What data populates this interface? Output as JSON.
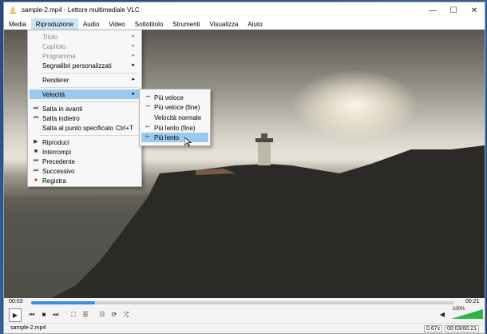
{
  "window": {
    "title": "sample-2.mp4 - Lettore multimediale VLC",
    "min_glyph": "—",
    "max_glyph": "☐",
    "close_glyph": "✕"
  },
  "menubar": [
    "Media",
    "Riproduzione",
    "Audio",
    "Video",
    "Sottotitolo",
    "Strumenti",
    "Visualizza",
    "Aiuto"
  ],
  "playback_menu": {
    "items": [
      {
        "label": "Titolo",
        "disabled": true,
        "submenu": true
      },
      {
        "label": "Capitolo",
        "disabled": true,
        "submenu": true
      },
      {
        "label": "Programma",
        "disabled": true,
        "submenu": true
      },
      {
        "label": "Segnalibri personalizzati",
        "disabled": false,
        "submenu": true
      },
      {
        "label": "Renderer",
        "disabled": false,
        "submenu": true
      },
      {
        "label": "Velocità",
        "disabled": false,
        "submenu": true,
        "highlighted": true
      },
      {
        "label": "Salta in avanti",
        "icon": "skip-forward-icon",
        "glyph": "⏭"
      },
      {
        "label": "Salta indietro",
        "icon": "skip-back-icon",
        "glyph": "⏮"
      },
      {
        "label": "Salta al punto specificato",
        "shortcut": "Ctrl+T"
      },
      {
        "label": "Riproduci",
        "icon": "play-icon",
        "glyph": "▶"
      },
      {
        "label": "Interrompi",
        "icon": "stop-icon",
        "glyph": "■"
      },
      {
        "label": "Precedente",
        "icon": "previous-icon",
        "glyph": "⏮"
      },
      {
        "label": "Successivo",
        "icon": "next-icon",
        "glyph": "⏭"
      },
      {
        "label": "Registra",
        "icon": "record-icon",
        "glyph": "●"
      }
    ]
  },
  "speed_menu": {
    "items": [
      {
        "label": "Più veloce",
        "icon": "faster-icon",
        "glyph": "⇀"
      },
      {
        "label": "Più veloce (fine)",
        "icon": "faster-fine-icon",
        "glyph": "⇀"
      },
      {
        "label": "Velocità normale",
        "icon": "normal-speed-icon",
        "glyph": ""
      },
      {
        "label": "Più lento (fine)",
        "icon": "slower-fine-icon",
        "glyph": "↼"
      },
      {
        "label": "Più lento",
        "icon": "slower-icon",
        "glyph": "↼",
        "highlighted": true
      }
    ]
  },
  "controls": {
    "elapsed": "00:03",
    "total": "00:21",
    "progress": 0.15,
    "volume_pct": "100%",
    "volume_level": 1.0,
    "speed": "0.67x",
    "time_status": "00:03/00:21",
    "filename": "sample-2.mp4",
    "glyphs": {
      "play": "▶",
      "prev": "⏮",
      "stop": "■",
      "next": "⏭",
      "fullscreen": "⛶",
      "extended": "☰",
      "playlist": "☷",
      "loop": "⟳",
      "random": "⤮",
      "volume": "◀"
    }
  },
  "colors": {
    "accent": "#3a8de0",
    "volume": "#2fb34a",
    "highlight": "#99c9ef",
    "record": "#d42020"
  }
}
